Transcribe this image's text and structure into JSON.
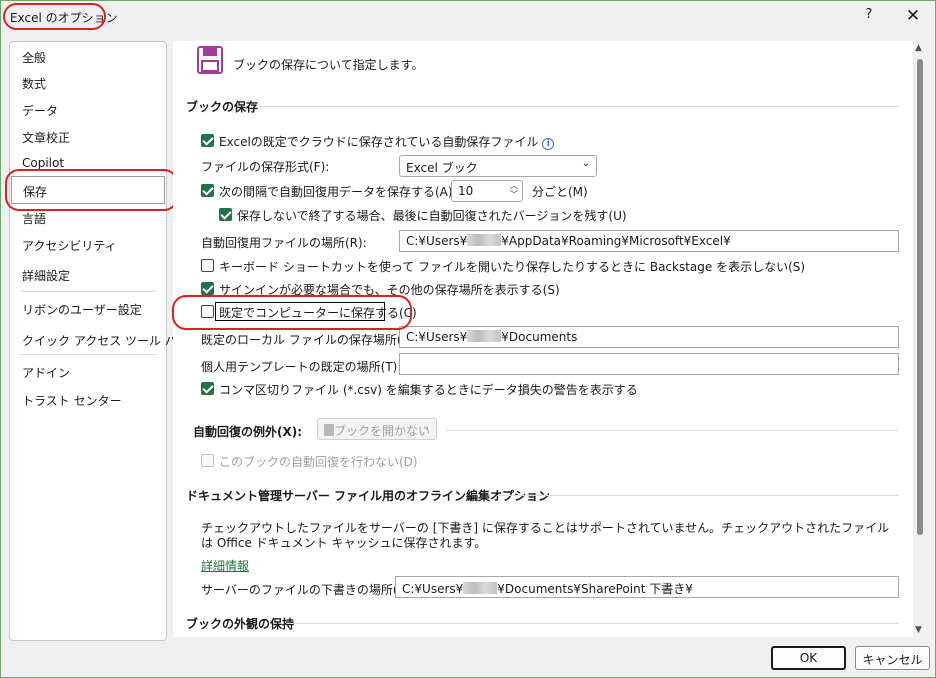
{
  "window": {
    "title": "Excel のオプション",
    "help_label": "?",
    "close_label": "✕"
  },
  "sidebar": {
    "items": [
      {
        "label": "全般"
      },
      {
        "label": "数式"
      },
      {
        "label": "データ"
      },
      {
        "label": "文章校正"
      },
      {
        "label": "Copilot"
      },
      {
        "label": "保存",
        "selected": true
      },
      {
        "label": "言語"
      },
      {
        "label": "アクセシビリティ"
      },
      {
        "label": "詳細設定"
      },
      {
        "label": "リボンのユーザー設定"
      },
      {
        "label": "クイック アクセス ツール バー"
      },
      {
        "label": "アドイン"
      },
      {
        "label": "トラスト センター"
      }
    ]
  },
  "main": {
    "header_text": "ブックの保存について指定します。",
    "header_icon": "save-disk-icon",
    "sections": {
      "save_workbooks": "ブックの保存",
      "autorecover_exceptions": "自動回復の例外(X):",
      "offline_editing": "ドキュメント管理サーバー ファイル用のオフライン編集オプション",
      "visual_appearance": "ブックの外観の保持"
    },
    "options": {
      "autosave_cloud": {
        "label": "Excelの既定でクラウドに保存されている自動保存ファイル",
        "checked": true
      },
      "save_format_label": "ファイルの保存形式(F):",
      "save_format_value": "Excel ブック",
      "autorecover_interval": {
        "label": "次の間隔で自動回復用データを保存する(A):",
        "checked": true,
        "value": "10",
        "unit": "分ごと(M)"
      },
      "keep_last_version": {
        "label": "保存しないで終了する場合、最後に自動回復されたバージョンを残す(U)",
        "checked": true
      },
      "autorecover_location_label": "自動回復用ファイルの場所(R):",
      "autorecover_location_value_pre": "C:¥Users¥",
      "autorecover_location_value_post": "¥AppData¥Roaming¥Microsoft¥Excel¥",
      "no_backstage": {
        "label": "キーボード ショートカットを使って ファイルを開いたり保存したりするときに Backstage を表示しない(S)",
        "checked": false
      },
      "show_additional_places": {
        "label": "サインインが必要な場合でも、その他の保存場所を表示する(S)",
        "checked": true
      },
      "save_to_computer": {
        "label": "既定でコンピューターに保存する(C)",
        "checked": false
      },
      "default_local_location_label": "既定のローカル ファイルの保存場所(I):",
      "default_local_location_value_pre": "C:¥Users¥",
      "default_local_location_value_post": "¥Documents",
      "personal_templates_label": "個人用テンプレートの既定の場所(T):",
      "personal_templates_value": "",
      "csv_warning": {
        "label": "コンマ区切りファイル (*.csv) を編集するときにデータ損失の警告を表示する",
        "checked": true
      },
      "exception_workbook": "ブックを開かない",
      "disable_autorecover": {
        "label": "このブックの自動回復を行わない(D)",
        "checked": false
      },
      "offline_note": "チェックアウトしたファイルをサーバーの [下書き] に保存することはサポートされていません。チェックアウトされたファイルは Office ドキュメント キャッシュに保存されます。",
      "more_info": "詳細情報",
      "server_drafts_label": "サーバーのファイルの下書きの場所(V):",
      "server_drafts_value_pre": "C:¥Users¥",
      "server_drafts_value_post": "¥Documents¥SharePoint 下書き¥"
    }
  },
  "footer": {
    "ok_label": "OK",
    "cancel_label": "キャンセル"
  },
  "colors": {
    "accent": "#217346",
    "highlight_ring": "#e02020"
  }
}
